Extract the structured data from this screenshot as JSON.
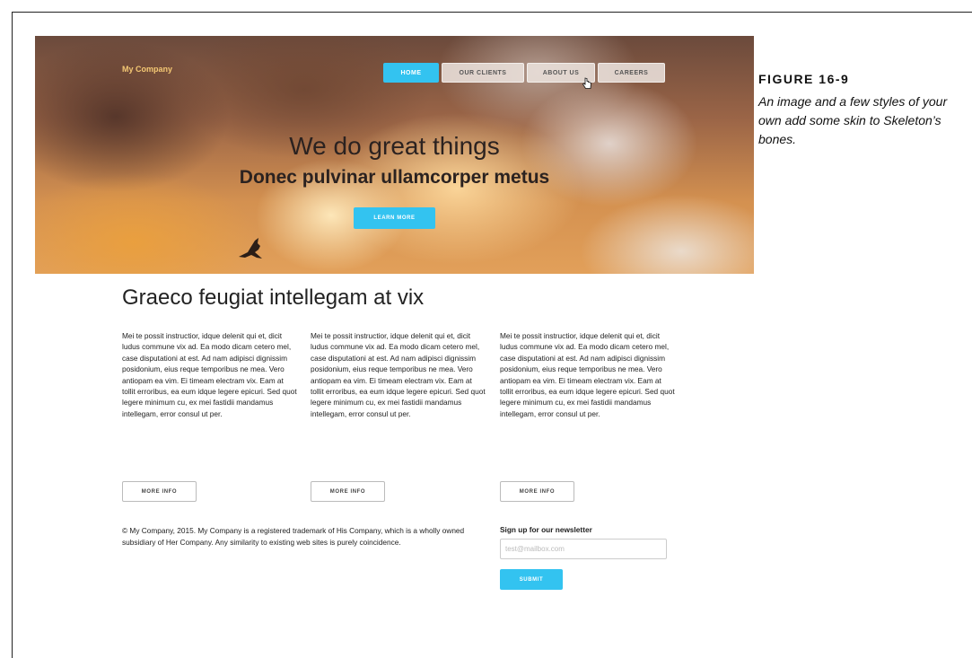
{
  "header": {
    "brand": "My Company",
    "nav": [
      {
        "label": "HOME",
        "active": true
      },
      {
        "label": "OUR CLIENTS",
        "active": false
      },
      {
        "label": "ABOUT US",
        "active": false
      },
      {
        "label": "CAREERS",
        "active": false
      }
    ]
  },
  "hero": {
    "title": "We do great things",
    "subtitle": "Donec pulvinar ullamcorper metus",
    "button_label": "LEARN MORE"
  },
  "figure": {
    "label": "FIGURE 16-9",
    "caption": "An image and a few styles of your own add some skin to Skeleton’s bones."
  },
  "main": {
    "title": "Graeco feugiat intellegam at vix",
    "columns": [
      {
        "text": "Mei te possit instructior, idque delenit qui et, dicit ludus commune vix ad. Ea modo dicam cetero mel, case disputationi at est. Ad nam adipisci dignissim posidonium, eius reque temporibus ne mea. Vero antiopam ea vim. Ei timeam electram vix. Eam at tollit erroribus, ea eum idque legere epicuri. Sed quot legere minimum cu, ex mei fastidii mandamus intellegam, error consul ut per.",
        "button_label": "MORE INFO"
      },
      {
        "text": "Mei te possit instructior, idque delenit qui et, dicit ludus commune vix ad. Ea modo dicam cetero mel, case disputationi at est. Ad nam adipisci dignissim posidonium, eius reque temporibus ne mea. Vero antiopam ea vim. Ei timeam electram vix. Eam at tollit erroribus, ea eum idque legere epicuri. Sed quot legere minimum cu, ex mei fastidii mandamus intellegam, error consul ut per.",
        "button_label": "MORE INFO"
      },
      {
        "text": "Mei te possit instructior, idque delenit qui et, dicit ludus commune vix ad. Ea modo dicam cetero mel, case disputationi at est. Ad nam adipisci dignissim posidonium, eius reque temporibus ne mea. Vero antiopam ea vim. Ei timeam electram vix. Eam at tollit erroribus, ea eum idque legere epicuri. Sed quot legere minimum cu, ex mei fastidii mandamus intellegam, error consul ut per.",
        "button_label": "MORE INFO"
      }
    ]
  },
  "footer": {
    "text": "© My Company, 2015. My Company is a registered trademark of His Company, which is a wholly owned subsidiary of Her Company. Any similarity to existing web sites is purely coincidence.",
    "newsletter_label": "Sign up for our newsletter",
    "email_placeholder": "test@mailbox.com",
    "submit_label": "SUBMIT"
  },
  "icons": {
    "cursor": "hand-pointer-icon",
    "bird": "bird-icon"
  },
  "colors": {
    "accent": "#33c3f0",
    "brand_text": "#f4c874"
  }
}
